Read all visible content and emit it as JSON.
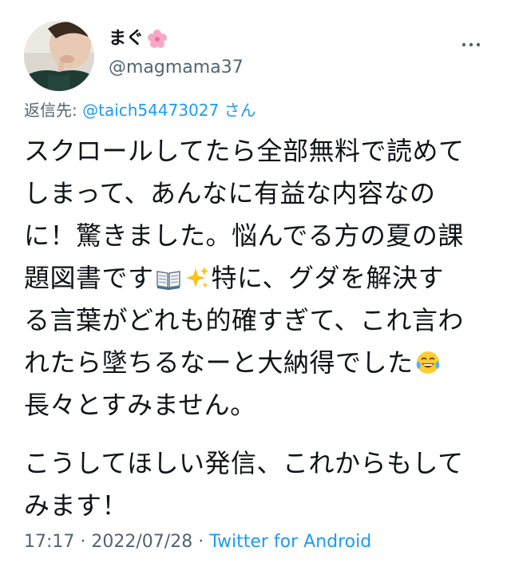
{
  "author": {
    "display_name": "まぐ",
    "name_emoji": "cherry-blossom-icon",
    "handle": "@magmama37"
  },
  "reply": {
    "prefix": "返信先:",
    "mention": "@taich54473027",
    "suffix": "さん"
  },
  "body": {
    "line1": "スクロールしてたら全部無料で読めて",
    "line2": "しまって、あんなに有益な内容なの",
    "line3": "に！驚きました。悩んでる方の夏の課",
    "line4a": "題図書です",
    "line4b": "特に、グダを解決す",
    "line5": "る言葉がどれも的確すぎて、これ言わ",
    "line6a": "れたら墜ちるなーと大納得でした",
    "line7": "長々とすみません。",
    "para2_line1": "こうしてほしい発信、これからもして",
    "para2_line2": "みます！"
  },
  "emojis": [
    "open-book-icon",
    "sparkles-icon",
    "tears-of-joy-icon"
  ],
  "meta": {
    "time": "17:17",
    "sep1": " · ",
    "date": "2022/07/28",
    "sep2": " · ",
    "source": "Twitter for Android"
  },
  "colors": {
    "text": "#0f1419",
    "secondary": "#536471",
    "link": "#1d9bf0"
  }
}
